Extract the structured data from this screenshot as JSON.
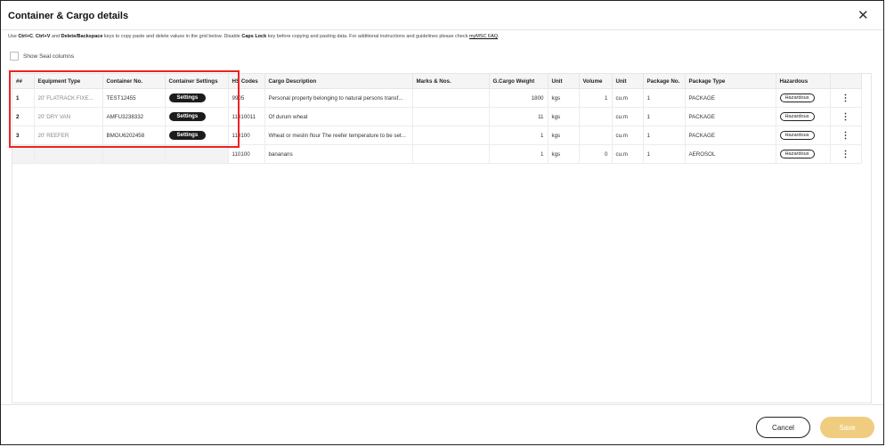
{
  "dialog": {
    "title": "Container & Cargo details",
    "close_glyph": "✕"
  },
  "info": {
    "p1": "Use ",
    "k1": "Ctrl+C",
    "p2": ", ",
    "k2": "Ctrl+V",
    "p3": " and ",
    "k3": "Delete/Backspace",
    "p4": " keys to copy paste and delete values in the grid below. Disable ",
    "k4": "Caps Lock",
    "p5": " key before copying and pasting data. For additional instructions and guidelines please check ",
    "link": "myMSC FAQ",
    "p6": "."
  },
  "seal": {
    "label": "Show Seal columns",
    "checked": false
  },
  "grid": {
    "headers": {
      "idx": "##",
      "equipment": "Equipment Type",
      "container_no": "Container No.",
      "settings": "Container Settings",
      "hs": "HS Codes",
      "desc": "Cargo Description",
      "marks": "Marks & Nos.",
      "weight": "G.Cargo Weight",
      "unit1": "Unit",
      "volume": "Volume",
      "unit2": "Unit",
      "pkg_no": "Package No.",
      "pkg_type": "Package Type",
      "hazardous": "Hazardous"
    },
    "rows": [
      {
        "idx": "1",
        "equipment": "20' FLATRACK FIXE...",
        "container_no": "TEST12455",
        "settings": "Settings",
        "hs": "9905",
        "desc": "Personal property belonging to natural persons transf...",
        "marks": "",
        "weight": "1800",
        "unit1": "kgs",
        "volume": "1",
        "unit2": "cu.m",
        "pkg_no": "1",
        "pkg_type": "PACKAGE",
        "hazardous": "Hazardous"
      },
      {
        "idx": "2",
        "equipment": "20' DRY VAN",
        "container_no": "AMFU3238332",
        "settings": "Settings",
        "hs": "11010011",
        "desc": "Of durum wheat",
        "marks": "",
        "weight": "11",
        "unit1": "kgs",
        "volume": "",
        "unit2": "cu.m",
        "pkg_no": "1",
        "pkg_type": "PACKAGE",
        "hazardous": "Hazardous"
      },
      {
        "idx": "3",
        "equipment": "20' REEFER",
        "container_no": "BMOU6202458",
        "settings": "Settings",
        "hs": "110100",
        "desc": "Wheat or meslin flour The reefer temperature to be set...",
        "marks": "",
        "weight": "1",
        "unit1": "kgs",
        "volume": "",
        "unit2": "cu.m",
        "pkg_no": "1",
        "pkg_type": "PACKAGE",
        "hazardous": "Hazardous"
      },
      {
        "idx": "",
        "equipment": "",
        "container_no": "",
        "settings": "",
        "hs": "110100",
        "desc": "bananans",
        "marks": "",
        "weight": "1",
        "unit1": "kgs",
        "volume": "0",
        "unit2": "cu.m",
        "pkg_no": "1",
        "pkg_type": "AEROSOL",
        "hazardous": "Hazardous"
      }
    ]
  },
  "footer": {
    "cancel": "Cancel",
    "save": "Save"
  },
  "colors": {
    "highlight": "#e22222",
    "save_bg": "#f0cd7e",
    "settings_bg": "#1c1c1c"
  },
  "icons": {
    "close": "close-icon",
    "row_menu": "kebab-menu-icon"
  }
}
